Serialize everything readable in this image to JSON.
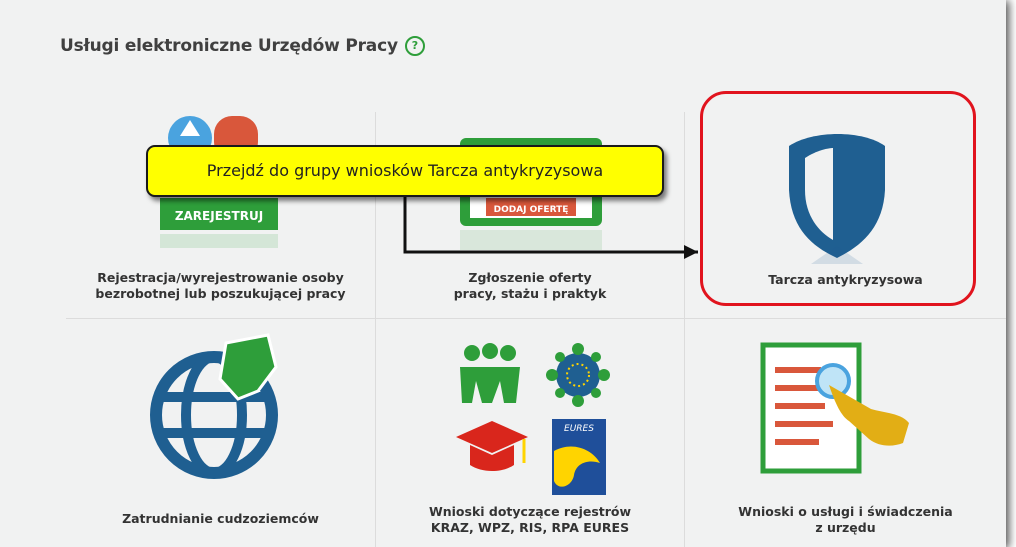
{
  "header": {
    "title": "Usługi elektroniczne Urzędów Pracy",
    "help_icon": "?"
  },
  "tiles": [
    {
      "label_line1": "Rejestracja/wyrejestrowanie osoby",
      "label_line2": "bezrobotnej lub poszukującej pracy",
      "button": "ZAREJESTRUJ",
      "icon": "register-icon"
    },
    {
      "label_line1": "Zgłoszenie oferty",
      "label_line2": "pracy, stażu i praktyk",
      "button": "DODAJ OFERTĘ",
      "icon": "job-offer-icon"
    },
    {
      "label_line1": "Tarcza antykryzysowa",
      "label_line2": "",
      "icon": "shield-icon"
    },
    {
      "label_line1": "Zatrudnianie cudzoziemców",
      "label_line2": "",
      "icon": "globe-icon"
    },
    {
      "label_line1": "Wnioski dotyczące rejestrów",
      "label_line2": "KRAZ, WPZ, RIS, RPA EURES",
      "badge": "EURES",
      "icon": "registers-icon"
    },
    {
      "label_line1": "Wnioski o usługi i świadczenia",
      "label_line2": "z urzędu",
      "icon": "document-touch-icon"
    }
  ],
  "callout": {
    "text": "Przejdź do grupy wniosków Tarcza antykryzysowa"
  },
  "colors": {
    "panel_bg": "#f1f2f2",
    "highlight": "#e1141e",
    "callout_bg": "#ffff00",
    "green": "#2e9e3a",
    "blue": "#1f5f91"
  }
}
